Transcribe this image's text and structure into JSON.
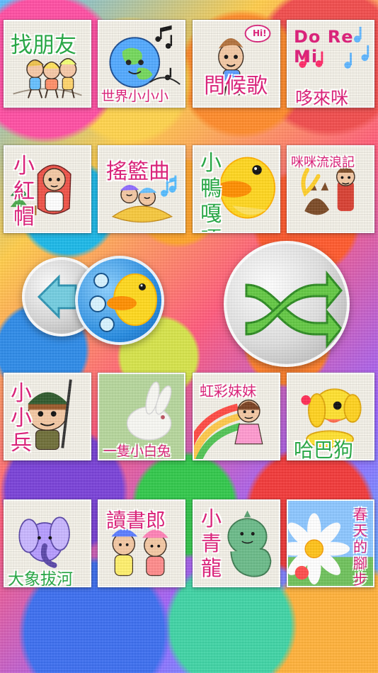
{
  "tiles": [
    {
      "label": "找朋友",
      "subtitle": "",
      "color": "#2aa747"
    },
    {
      "label": "世界小小小",
      "subtitle": "",
      "color": "#d9247a"
    },
    {
      "label": "問候歌",
      "subtitle": "Hi!",
      "color": "#d9247a"
    },
    {
      "label": "哆來咪",
      "subtitle": "Do Re Mi",
      "color": "#d9247a"
    },
    {
      "label": "小紅帽",
      "subtitle": "",
      "color": "#d9247a"
    },
    {
      "label": "搖籃曲",
      "subtitle": "",
      "color": "#d9247a"
    },
    {
      "label": "小鴨嘎嘎",
      "subtitle": "",
      "color": "#d9247a"
    },
    {
      "label": "咪咪流浪記",
      "subtitle": "",
      "color": "#d9247a"
    },
    {
      "label": "小小兵",
      "subtitle": "",
      "color": "#d9247a"
    },
    {
      "label": "一隻小白兔",
      "subtitle": "",
      "color": "#d9247a"
    },
    {
      "label": "虹彩妹妹",
      "subtitle": "",
      "color": "#d9247a"
    },
    {
      "label": "哈巴狗",
      "subtitle": "",
      "color": "#2aa747"
    },
    {
      "label": "大象拔河",
      "subtitle": "",
      "color": "#2aa747"
    },
    {
      "label": "讀書郎",
      "subtitle": "",
      "color": "#d9247a"
    },
    {
      "label": "小青龍",
      "subtitle": "",
      "color": "#d9247a"
    },
    {
      "label": "春天的腳步",
      "subtitle": "",
      "color": "#d9247a"
    }
  ],
  "controls": {
    "back": {
      "icon": "back-arrow-icon"
    },
    "playlist": {
      "icon": "music-note-icon"
    },
    "shuffle": {
      "icon": "shuffle-icon"
    }
  },
  "colors": {
    "pink": "#d9247a",
    "green": "#2aa747",
    "blue": "#1fa2dc",
    "yellow": "#ffd21f",
    "orange": "#ff8a00"
  }
}
